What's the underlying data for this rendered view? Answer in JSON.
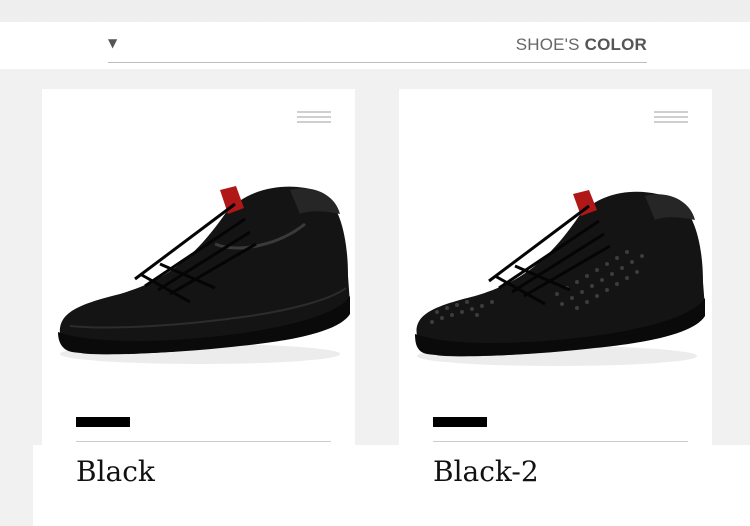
{
  "header": {
    "dropdown_caret": "▼",
    "title_light": "SHOE'S",
    "title_bold": "COLOR"
  },
  "products": [
    {
      "color_name": "Black",
      "swatch_color": "#000000",
      "image": "black-leather-sneaker"
    },
    {
      "color_name": "Black-2",
      "swatch_color": "#000000",
      "image": "black-perforated-leather-sneaker"
    }
  ],
  "icons": {
    "menu": "menu-lines-icon",
    "dropdown": "caret-down-icon"
  }
}
